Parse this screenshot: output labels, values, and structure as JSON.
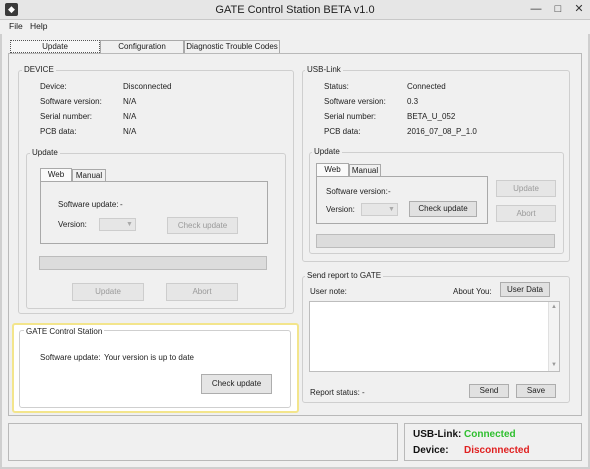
{
  "window": {
    "title": "GATE Control Station BETA v1.0",
    "icon": "app-icon",
    "controls": [
      "—",
      "□",
      "✕"
    ]
  },
  "menu": {
    "file": "File",
    "help": "Help"
  },
  "tabs": [
    "Update",
    "Configuration",
    "Diagnostic Trouble Codes"
  ],
  "device": {
    "title": "DEVICE",
    "rows": [
      {
        "label": "Device:",
        "value": "Disconnected"
      },
      {
        "label": "Software version:",
        "value": "N/A"
      },
      {
        "label": "Serial number:",
        "value": "N/A"
      },
      {
        "label": "PCB data:",
        "value": "N/A"
      }
    ],
    "update": {
      "title": "Update",
      "tabs": [
        "Web",
        "Manual"
      ],
      "software_update_label": "Software update:",
      "software_update_value": "-",
      "version_label": "Version:",
      "check_update": "Check update",
      "update_button": "Update",
      "abort_button": "Abort"
    }
  },
  "usb": {
    "title": "USB-Link",
    "rows": [
      {
        "label": "Status:",
        "value": "Connected"
      },
      {
        "label": "Software version:",
        "value": "0.3"
      },
      {
        "label": "Serial number:",
        "value": "BETA_U_052"
      },
      {
        "label": "PCB data:",
        "value": "2016_07_08_P_1.0"
      }
    ],
    "update": {
      "title": "Update",
      "tabs": [
        "Web",
        "Manual"
      ],
      "software_version_label": "Software version:",
      "software_version_value": "-",
      "version_label": "Version:",
      "check_update": "Check update",
      "update_button": "Update",
      "abort_button": "Abort"
    }
  },
  "report": {
    "title": "Send report to GATE",
    "user_note_label": "User note:",
    "about_you_label": "About You:",
    "user_data_button": "User Data",
    "report_status_label": "Report status:",
    "report_status_value": "-",
    "send_button": "Send",
    "save_button": "Save"
  },
  "gcs": {
    "title": "GATE Control Station",
    "software_update_label": "Software update:",
    "software_update_value": "Your version is up to date",
    "check_update": "Check update"
  },
  "status": {
    "usb_label": "USB-Link:",
    "usb_value": "Connected",
    "device_label": "Device:",
    "device_value": "Disconnected",
    "colors": {
      "connected": "#2fbf2f",
      "disconnected": "#e02020"
    }
  }
}
